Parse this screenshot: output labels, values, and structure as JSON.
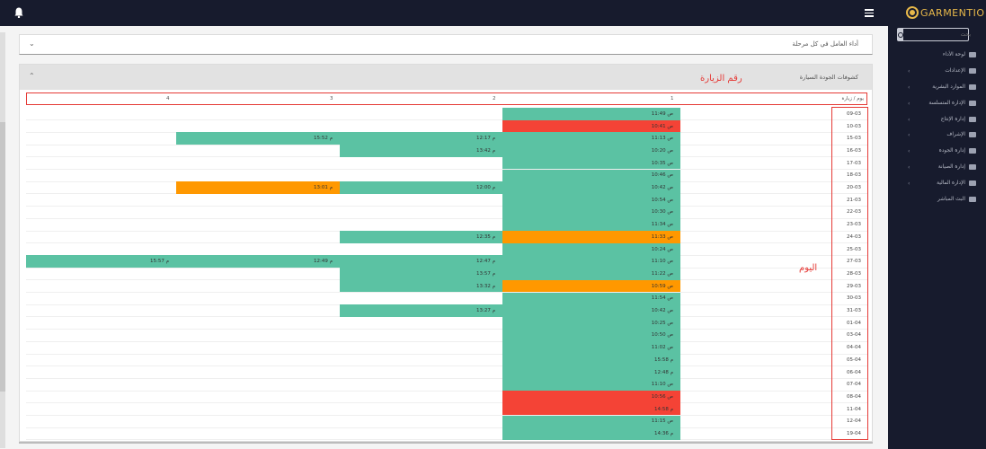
{
  "header": {
    "bell_icon": "bell-icon",
    "menu_icon": "hamburger-icon"
  },
  "sidebar": {
    "logo_text": "GARMENTIO",
    "search_placeholder": "بحث",
    "items": [
      {
        "label": "لوحة الأداء",
        "icon": "dashboard-icon",
        "chevron": false
      },
      {
        "label": "الإعدادات",
        "icon": "sliders-icon",
        "chevron": true
      },
      {
        "label": "الموارد البشرية",
        "icon": "users-icon",
        "chevron": true
      },
      {
        "label": "الإدارة المتسلسة",
        "icon": "cloud-icon",
        "chevron": true
      },
      {
        "label": "إدارة الإنتاج",
        "icon": "pie-icon",
        "chevron": true
      },
      {
        "label": "الإشراف",
        "icon": "list-icon",
        "chevron": true
      },
      {
        "label": "إدارة الجودة",
        "icon": "clipboard-icon",
        "chevron": true
      },
      {
        "label": "إدارة الصيانة",
        "icon": "tools-icon",
        "chevron": true
      },
      {
        "label": "الإدارة المالية",
        "icon": "money-icon",
        "chevron": true
      },
      {
        "label": "البث المباشر",
        "icon": "rss-icon",
        "chevron": false
      }
    ]
  },
  "cards": {
    "worker_performance_title": "أداء العامل في كل مرحلة",
    "quality_title": "كشوفات الجودة السيارة"
  },
  "annotations": {
    "visit_number": "رقم الزيارة",
    "day": "اليوم"
  },
  "table": {
    "corner_header": "يوم / زيارة",
    "columns": [
      "1",
      "2",
      "3",
      "4"
    ],
    "colors": {
      "green": "#5bc2a3",
      "red": "#f44336",
      "orange": "#ff9800"
    },
    "rows": [
      {
        "date": "09-03",
        "cells": [
          {
            "t": "11:49 ص",
            "c": "green"
          }
        ]
      },
      {
        "date": "10-03",
        "cells": [
          {
            "t": "10:41 ص",
            "c": "red"
          }
        ]
      },
      {
        "date": "15-03",
        "cells": [
          {
            "t": "11:13 ص",
            "c": "green"
          },
          {
            "t": "12:17 م",
            "c": "green"
          },
          {
            "t": "15:52 م",
            "c": "green"
          }
        ]
      },
      {
        "date": "16-03",
        "cells": [
          {
            "t": "10:20 ص",
            "c": "green"
          },
          {
            "t": "13:42 م",
            "c": "green"
          }
        ]
      },
      {
        "date": "17-03",
        "cells": [
          {
            "t": "10:35 ص",
            "c": "green"
          }
        ]
      },
      {
        "date": "18-03",
        "cells": [
          {
            "t": "10:46 ص",
            "c": "green"
          }
        ]
      },
      {
        "date": "20-03",
        "cells": [
          {
            "t": "10:42 ص",
            "c": "green"
          },
          {
            "t": "12:00 م",
            "c": "green"
          },
          {
            "t": "13:01 م",
            "c": "orange"
          }
        ]
      },
      {
        "date": "21-03",
        "cells": [
          {
            "t": "10:54 ص",
            "c": "green"
          }
        ]
      },
      {
        "date": "22-03",
        "cells": [
          {
            "t": "10:30 ص",
            "c": "green"
          }
        ]
      },
      {
        "date": "23-03",
        "cells": [
          {
            "t": "11:34 ص",
            "c": "green"
          }
        ]
      },
      {
        "date": "24-03",
        "cells": [
          {
            "t": "11:33 ص",
            "c": "orange"
          },
          {
            "t": "12:35 م",
            "c": "green"
          }
        ]
      },
      {
        "date": "25-03",
        "cells": [
          {
            "t": "10:24 ص",
            "c": "green"
          }
        ]
      },
      {
        "date": "27-03",
        "cells": [
          {
            "t": "11:10 ص",
            "c": "green"
          },
          {
            "t": "12:47 م",
            "c": "green"
          },
          {
            "t": "12:49 م",
            "c": "green"
          },
          {
            "t": "15:57 م",
            "c": "green"
          }
        ]
      },
      {
        "date": "28-03",
        "cells": [
          {
            "t": "11:22 ص",
            "c": "green"
          },
          {
            "t": "13:57 م",
            "c": "green"
          }
        ]
      },
      {
        "date": "29-03",
        "cells": [
          {
            "t": "10:59 ص",
            "c": "orange"
          },
          {
            "t": "13:32 م",
            "c": "green"
          }
        ]
      },
      {
        "date": "30-03",
        "cells": [
          {
            "t": "11:54 ص",
            "c": "green"
          }
        ]
      },
      {
        "date": "31-03",
        "cells": [
          {
            "t": "10:42 ص",
            "c": "green"
          },
          {
            "t": "13:27 م",
            "c": "green"
          }
        ]
      },
      {
        "date": "01-04",
        "cells": [
          {
            "t": "10:25 ص",
            "c": "green"
          }
        ]
      },
      {
        "date": "03-04",
        "cells": [
          {
            "t": "10:50 ص",
            "c": "green"
          }
        ]
      },
      {
        "date": "04-04",
        "cells": [
          {
            "t": "11:02 ص",
            "c": "green"
          }
        ]
      },
      {
        "date": "05-04",
        "cells": [
          {
            "t": "15:58 م",
            "c": "green"
          }
        ]
      },
      {
        "date": "06-04",
        "cells": [
          {
            "t": "12:48 م",
            "c": "green"
          }
        ]
      },
      {
        "date": "07-04",
        "cells": [
          {
            "t": "11:10 ص",
            "c": "green"
          }
        ]
      },
      {
        "date": "08-04",
        "cells": [
          {
            "t": "10:56 ص",
            "c": "red"
          }
        ]
      },
      {
        "date": "11-04",
        "cells": [
          {
            "t": "14:58 م",
            "c": "red"
          }
        ]
      },
      {
        "date": "12-04",
        "cells": [
          {
            "t": "11:15 ص",
            "c": "green"
          }
        ]
      },
      {
        "date": "19-04",
        "cells": [
          {
            "t": "14:36 م",
            "c": "green"
          }
        ]
      }
    ]
  }
}
